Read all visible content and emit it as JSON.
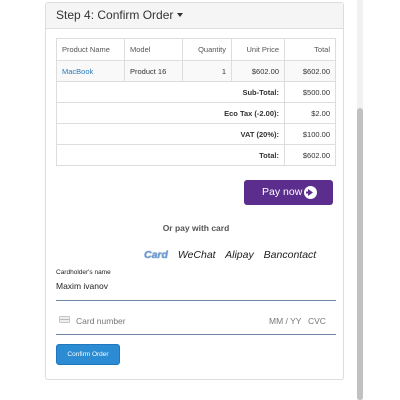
{
  "step": {
    "title": "Step 4: Confirm Order"
  },
  "cart": {
    "headers": [
      "Product Name",
      "Model",
      "Quantity",
      "Unit Price",
      "Total"
    ],
    "items": [
      {
        "name": "MacBook",
        "model": "Product 16",
        "quantity": "1",
        "unit_price": "$602.00",
        "total": "$602.00"
      }
    ],
    "totals": [
      {
        "label": "Sub-Total:",
        "value": "$500.00"
      },
      {
        "label": "Eco Tax (-2.00):",
        "value": "$2.00"
      },
      {
        "label": "VAT (20%):",
        "value": "$100.00"
      },
      {
        "label": "Total:",
        "value": "$602.00"
      }
    ]
  },
  "pay_now": {
    "label": "Pay now",
    "color": "#5b2d8c"
  },
  "or_pay": {
    "label": "Or pay with card"
  },
  "methods": [
    "Card",
    "WeChat",
    "Alipay",
    "Bancontact"
  ],
  "cardholder": {
    "label": "Cardholder's name",
    "value": "Maxim ivanov"
  },
  "card": {
    "number_placeholder": "Card number",
    "expiry_placeholder": "MM / YY",
    "cvc_placeholder": "CVC"
  },
  "confirm": {
    "label": "Confirm Order",
    "color": "#2b8bd3"
  }
}
